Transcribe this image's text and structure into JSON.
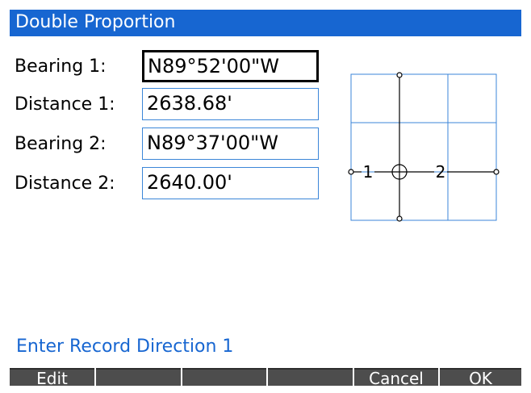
{
  "title": "Double Proportion",
  "fields": [
    {
      "label": "Bearing 1:",
      "value": "N89°52'00\"W"
    },
    {
      "label": "Distance 1:",
      "value": "2638.68'"
    },
    {
      "label": "Bearing 2:",
      "value": "N89°37'00\"W"
    },
    {
      "label": "Distance 2:",
      "value": "2640.00'"
    }
  ],
  "diagram": {
    "label_1": "1",
    "label_2": "2"
  },
  "status": "Enter Record Direction 1",
  "softkeys": [
    "Edit",
    "",
    "",
    "",
    "Cancel",
    "OK"
  ],
  "colors": {
    "accent": "#1766d1",
    "softkey_bg": "#4d4d4d",
    "grid": "#3b86d8"
  }
}
